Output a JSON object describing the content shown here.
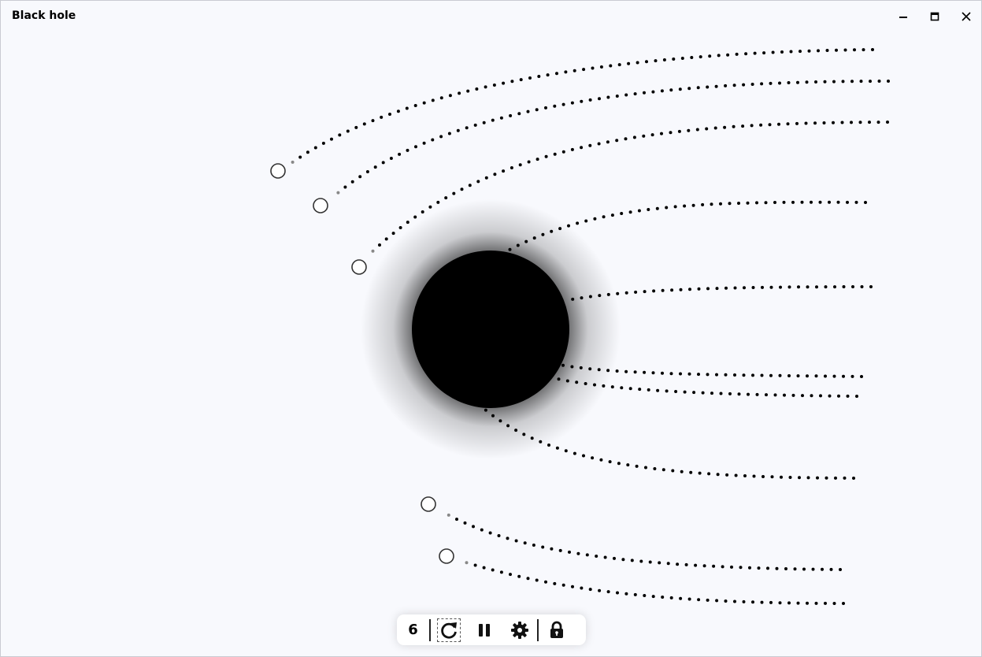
{
  "window": {
    "title": "Black hole"
  },
  "toolbar": {
    "count": "6",
    "buttons": [
      {
        "icon": "restart-icon"
      },
      {
        "icon": "pause-icon"
      },
      {
        "icon": "settings-icon"
      },
      {
        "icon": "lock-icon"
      }
    ]
  },
  "colors": {
    "background": "#f8f9fd",
    "black_hole": "#000000",
    "trail_dot": "#000000",
    "trail_recent": "#888888",
    "particle_fill": "#ffffff",
    "particle_stroke": "#333333"
  }
}
